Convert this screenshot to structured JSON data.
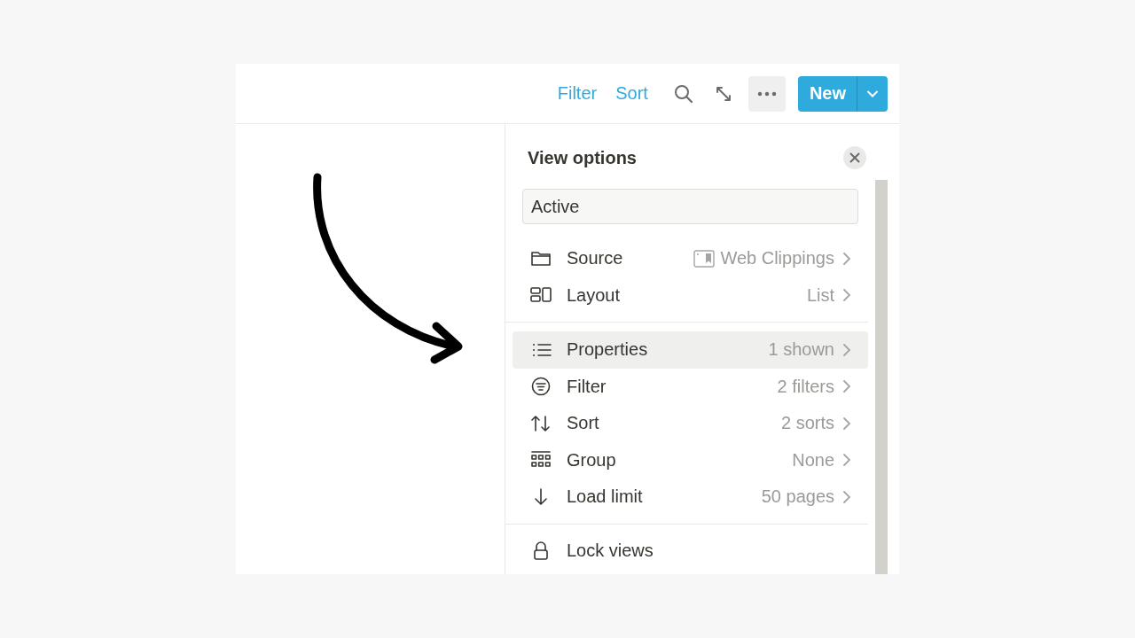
{
  "toolbar": {
    "links": [
      "Filter",
      "Sort"
    ],
    "new_button": "New"
  },
  "view_options": {
    "title": "View options",
    "name_field": {
      "value": "Active"
    },
    "sections": [
      {
        "items": [
          {
            "kind": "icon-value",
            "label": "Source",
            "value": "Web Clippings",
            "selected": false
          },
          {
            "kind": "value",
            "label": "Layout",
            "value": "List",
            "selected": false
          }
        ]
      },
      {
        "items": [
          {
            "kind": "value",
            "label": "Properties",
            "value": "1 shown",
            "selected": true
          },
          {
            "kind": "value",
            "label": "Filter",
            "value": "2 filters",
            "selected": false
          },
          {
            "kind": "value",
            "label": "Sort",
            "value": "2 sorts",
            "selected": false
          },
          {
            "kind": "value",
            "label": "Group",
            "value": "None",
            "selected": false
          },
          {
            "kind": "value",
            "label": "Load limit",
            "value": "50 pages",
            "selected": false
          }
        ]
      },
      {
        "items": [
          {
            "kind": "action",
            "label": "Lock views",
            "selected": false
          }
        ]
      }
    ]
  }
}
